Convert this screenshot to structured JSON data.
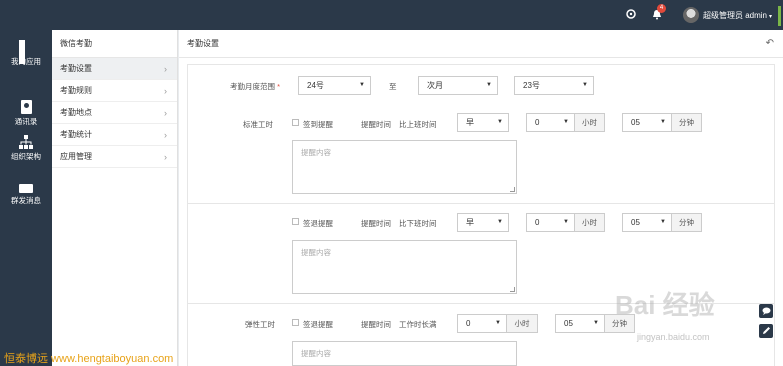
{
  "topbar": {
    "icons": [
      "apps-grid-icon",
      "bell-icon"
    ],
    "notification_count": "4",
    "user_label": "超级管理员 admin",
    "caret": "▾"
  },
  "nav_rail": {
    "items": [
      {
        "label": "我的应用",
        "icon": "apps-icon"
      },
      {
        "label": "通讯录",
        "icon": "contacts-icon"
      },
      {
        "label": "组织架构",
        "icon": "org-chart-icon"
      },
      {
        "label": "群发消息",
        "icon": "message-icon"
      }
    ]
  },
  "submenu": {
    "title": "微信考勤",
    "items": [
      {
        "label": "考勤设置",
        "active": true
      },
      {
        "label": "考勤规则",
        "active": false
      },
      {
        "label": "考勤地点",
        "active": false
      },
      {
        "label": "考勤统计",
        "active": false
      },
      {
        "label": "应用管理",
        "active": false
      }
    ],
    "chevron": "›"
  },
  "main": {
    "title": "考勤设置",
    "back_icon": "↶",
    "range": {
      "label": "考勤月度范围",
      "required_mark": "*",
      "start_day": "24号",
      "to_label": "至",
      "end_month": "次月",
      "end_day": "23号"
    },
    "standard": {
      "label": "标准工时",
      "sign_in": {
        "checkbox_label": "签到提醒",
        "remind_time_label": "提醒时间",
        "compare_label": "比上班时间",
        "relation": "早",
        "hours": "0",
        "hour_unit": "小时",
        "minutes": "05",
        "minute_unit": "分钟",
        "textarea_placeholder": "提醒内容"
      },
      "sign_out": {
        "checkbox_label": "签退提醒",
        "remind_time_label": "提醒时间",
        "compare_label": "比下班时间",
        "relation": "早",
        "hours": "0",
        "hour_unit": "小时",
        "minutes": "05",
        "minute_unit": "分钟",
        "textarea_placeholder": "提醒内容"
      }
    },
    "flexible": {
      "label": "弹性工时",
      "checkbox_label": "签退提醒",
      "remind_time_label": "提醒时间",
      "compare_label": "工作时长满",
      "hours": "0",
      "hour_unit": "小时",
      "minutes": "05",
      "minute_unit": "分钟",
      "textarea_placeholder": "提醒内容"
    }
  },
  "side_buttons": [
    "chat-icon",
    "edit-icon"
  ],
  "watermarks": {
    "site": "恒泰博远 www.hengtaiboyuan.com",
    "baidu": "Bai 经验",
    "baidu_url": "jingyan.baidu.com"
  },
  "colors": {
    "dark_nav": "#2b3949",
    "badge_red": "#e24a3b",
    "accent_green": "#7ab648",
    "watermark_orange": "#e8a319"
  }
}
